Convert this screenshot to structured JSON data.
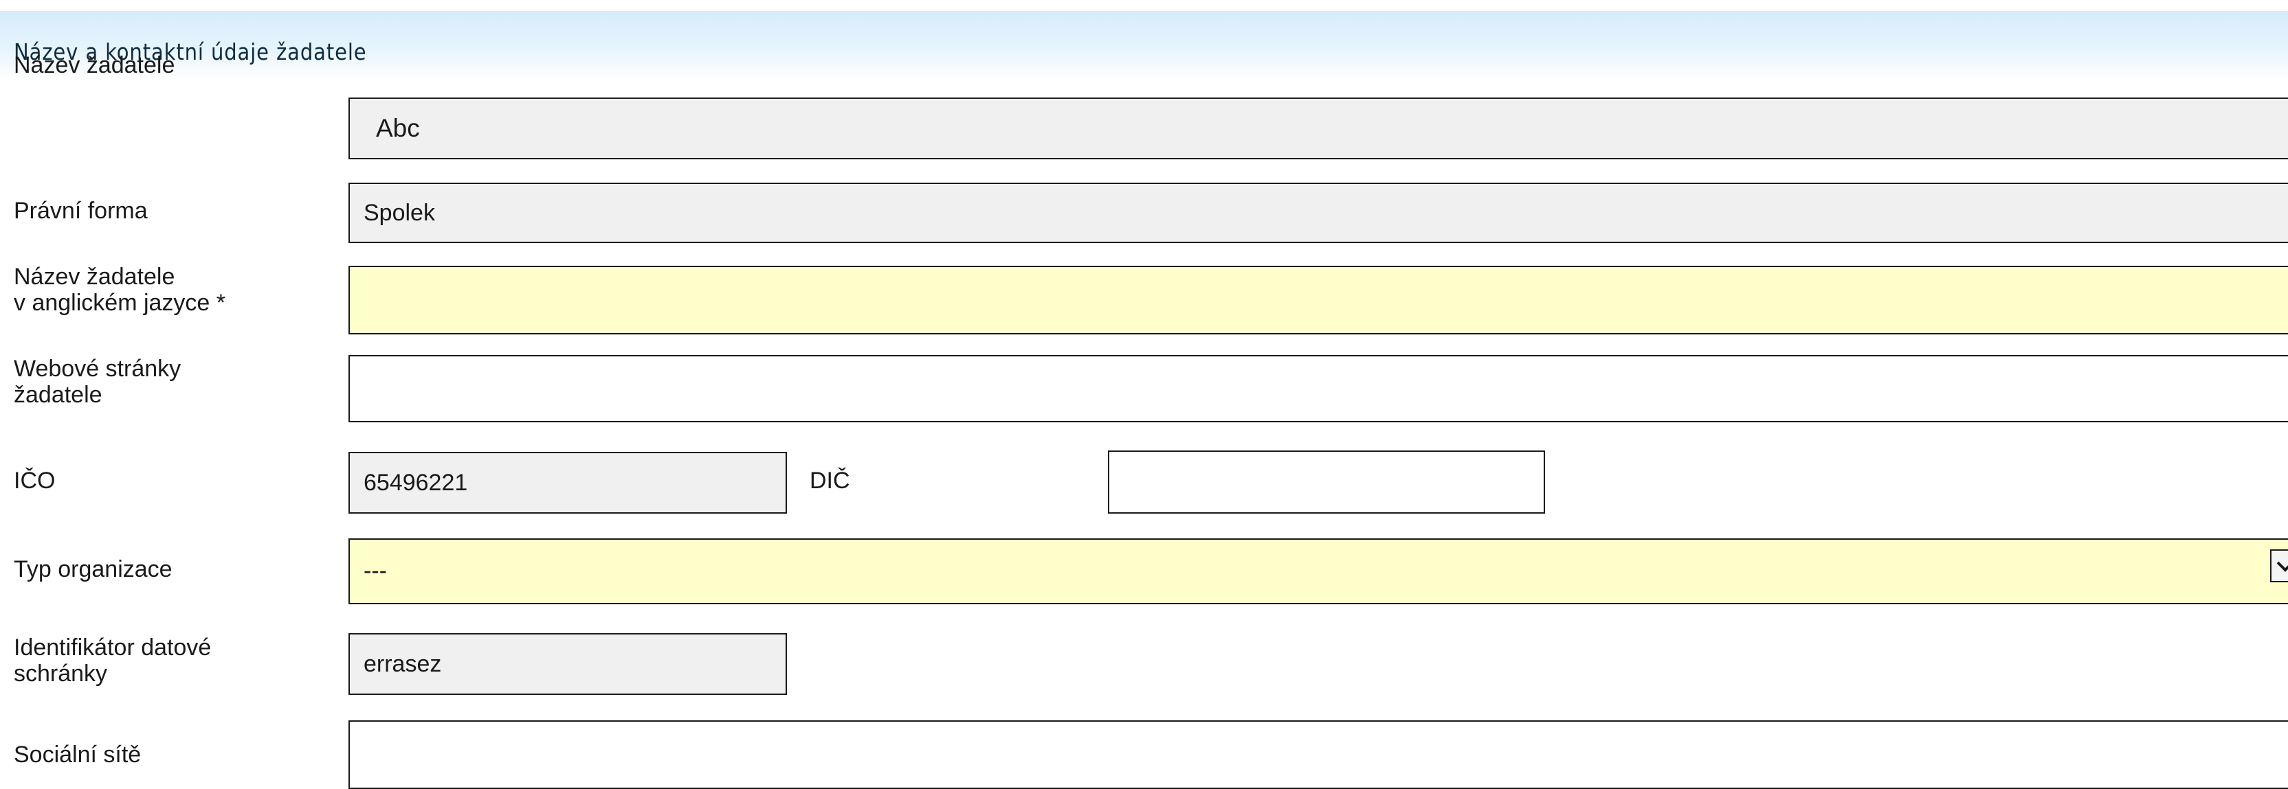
{
  "section": {
    "title": "Název a kontaktní údaje žadatele"
  },
  "fields": {
    "nazev": {
      "label": "Název žadatele",
      "value": "Abc"
    },
    "pravni_forma": {
      "label": "Právní forma",
      "value": "Spolek"
    },
    "nazev_en": {
      "label_line1": "Název žadatele",
      "label_line2": "v anglickém jazyce *",
      "value": ""
    },
    "web": {
      "label_line1": "Webové stránky",
      "label_line2": "žadatele",
      "value": ""
    },
    "ico": {
      "label": "IČO",
      "value": "65496221"
    },
    "dic": {
      "label": "DIČ",
      "value": ""
    },
    "typ_organizace": {
      "label": "Typ organizace",
      "selected": "---"
    },
    "datova_schranka": {
      "label_line1": "Identifikátor datové",
      "label_line2": "schránky",
      "value": "errasez"
    },
    "socialni_site": {
      "label": "Sociální sítě",
      "value": ""
    }
  },
  "icons": {
    "dropdown": "chevron-down-icon"
  },
  "colors": {
    "header_gradient_top": "#d5ecfa",
    "readonly_bg": "#f0f0f0",
    "required_bg": "#ffffcc",
    "border": "#1a1a1a"
  }
}
